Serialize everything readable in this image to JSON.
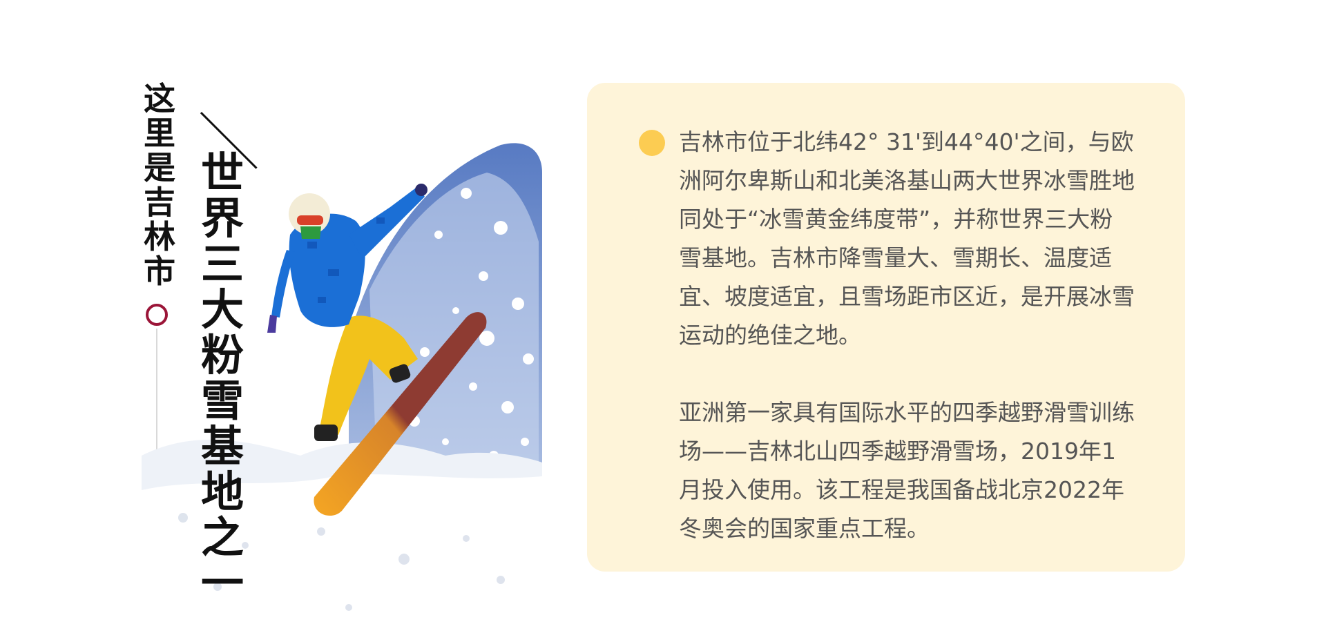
{
  "title": {
    "small": [
      "这",
      "里",
      "是",
      "吉",
      "林",
      "市"
    ],
    "big": [
      "世",
      "界",
      "三",
      "大",
      "粉",
      "雪",
      "基",
      "地",
      "之",
      "一"
    ]
  },
  "illustration": {
    "icon": "snowboarder-illustration"
  },
  "info": {
    "paragraph1": "吉林市位于北纬42° 31'到44°40'之间，与欧洲阿尔卑斯山和北美洛基山两大世界冰雪胜地同处于“冰雪黄金纬度带”，并称世界三大粉雪基地。吉林市降雪量大、雪期长、温度适宜、坡度适宜，且雪场距市区近，是开展冰雪运动的绝佳之地。",
    "paragraph2": "亚洲第一家具有国际水平的四季越野滑雪训练场——吉林北山四季越野滑雪场，2019年1月投入使用。该工程是我国备战北京2022年冬奥会的国家重点工程。"
  },
  "colors": {
    "card_bg": "#fef4d9",
    "bullet": "#fccc52",
    "ring": "#9b1538",
    "text": "#555555",
    "title": "#111111"
  }
}
